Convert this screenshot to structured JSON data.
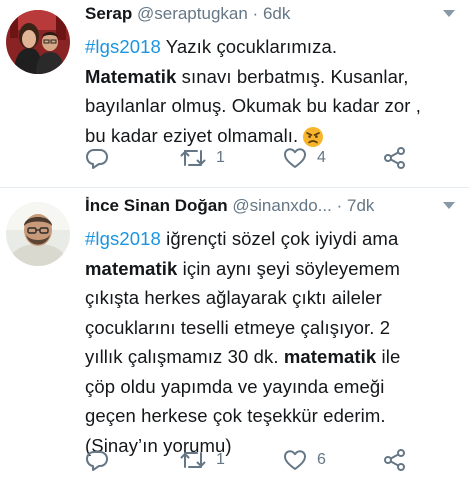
{
  "tweets": [
    {
      "name": "Serap",
      "handle": "@seraptugkan",
      "separator": "·",
      "time": "6dk",
      "lines": [
        [
          {
            "t": "#lgs2018",
            "s": "hashtag"
          },
          {
            "t": " Yazık çocuklarımıza."
          }
        ],
        [
          {
            "t": "Matematik",
            "s": "strong"
          },
          {
            "t": " sınavı berbatmış.  Kusanlar,"
          }
        ],
        [
          {
            "t": "bayılanlar olmuş.  Okumak bu kadar zor ,"
          }
        ],
        [
          {
            "t": "bu kadar eziyet olmamalı."
          }
        ]
      ],
      "emoji": "angry-face-emoji",
      "retweets": "1",
      "likes": "4"
    },
    {
      "name": "İnce Sinan Doğan",
      "handle": "@sinanxdo...",
      "separator": "·",
      "time": "7dk",
      "lines": [
        [
          {
            "t": "#lgs2018",
            "s": "hashtag"
          },
          {
            "t": " iğrençti sözel çok iyiydi ama"
          }
        ],
        [
          {
            "t": "matematik",
            "s": "strong"
          },
          {
            "t": " için aynı şeyi söyleyemem"
          }
        ],
        [
          {
            "t": "çıkışta herkes ağlayarak çıktı aileler"
          }
        ],
        [
          {
            "t": "çocuklarını teselli etmeye çalışıyor. 2"
          }
        ],
        [
          {
            "t": "yıllık çalışmamız 30 dk. "
          },
          {
            "t": "matematik",
            "s": "strong"
          },
          {
            "t": " ile"
          }
        ],
        [
          {
            "t": "çöp oldu yapımda ve yayında emeği"
          }
        ],
        [
          {
            "t": "geçen herkese çok teşekkür ederim."
          }
        ],
        [
          {
            "t": "(Sinay’ın yorumu)"
          }
        ]
      ],
      "retweets": "1",
      "likes": "6"
    }
  ],
  "colors": {
    "hashtag": "#1b95e0",
    "secondary_text": "#657786",
    "icon": "#657786",
    "divider": "#e6ecf0"
  },
  "icons": [
    "reply-icon",
    "retweet-icon",
    "like-icon",
    "share-icon",
    "caret-down-icon"
  ]
}
